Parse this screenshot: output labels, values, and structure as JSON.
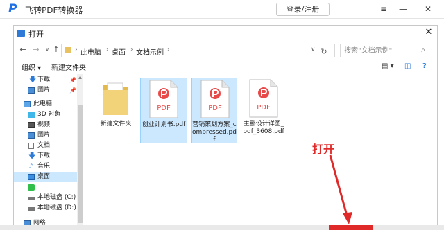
{
  "app": {
    "logo": "P",
    "title": "飞转PDF转换器",
    "login_label": "登录/注册",
    "menu_icon": "≡",
    "minimize_icon": "—",
    "close_icon": "✕"
  },
  "dialog": {
    "title": "打开",
    "close_icon": "✕",
    "nav": {
      "back": "←",
      "forward": "→",
      "recent": "∨",
      "up": "↑"
    },
    "breadcrumb": [
      "此电脑",
      "桌面",
      "文档示例"
    ],
    "breadcrumb_sep": "›",
    "address_dropdown": "∨",
    "refresh": "↻",
    "search_placeholder": "搜索\"文档示例\"",
    "search_icon": "⌕",
    "toolbar": {
      "organize_label": "组织 ▾",
      "new_folder_label": "新建文件夹"
    },
    "sidebar": [
      {
        "label": "下载",
        "icon": "download-arrow-icon",
        "pinned": true
      },
      {
        "label": "图片",
        "icon": "picture-icon",
        "pinned": true
      },
      {
        "label": "此电脑",
        "icon": "computer-icon",
        "pinned": false
      },
      {
        "label": "3D 对象",
        "icon": "3d-objects-icon",
        "pinned": false
      },
      {
        "label": "视频",
        "icon": "video-icon",
        "pinned": false
      },
      {
        "label": "图片",
        "icon": "picture-icon",
        "pinned": false
      },
      {
        "label": "文档",
        "icon": "document-icon",
        "pinned": false
      },
      {
        "label": "下载",
        "icon": "download-arrow-icon",
        "pinned": false
      },
      {
        "label": "音乐",
        "icon": "music-icon",
        "pinned": false
      },
      {
        "label": "桌面",
        "icon": "desktop-icon",
        "pinned": false,
        "selected": true
      },
      {
        "label": "",
        "icon": "app-green-icon",
        "pinned": false
      },
      {
        "label": "本地磁盘 (C:)",
        "icon": "drive-icon",
        "pinned": false
      },
      {
        "label": "本地磁盘 (D:)",
        "icon": "drive-icon",
        "pinned": false
      },
      {
        "label": "网络",
        "icon": "network-icon",
        "pinned": false
      }
    ],
    "files": [
      {
        "name": "新建文件夹",
        "type": "folder"
      },
      {
        "name": "创业计划书.pdf",
        "type": "pdf",
        "selected": true
      },
      {
        "name": "营销策划方案_compressed.pdf",
        "type": "pdf",
        "selected": true
      },
      {
        "name": "主卧设计详图_pdf_3608.pdf",
        "type": "pdf"
      }
    ],
    "pdf_badge": "PDF"
  },
  "annotation": {
    "text": "打开",
    "color": "#e02a2a"
  },
  "colors": {
    "accent": "#1f6fe5",
    "selection": "#cce8ff",
    "pdf_red": "#e84a4a"
  }
}
